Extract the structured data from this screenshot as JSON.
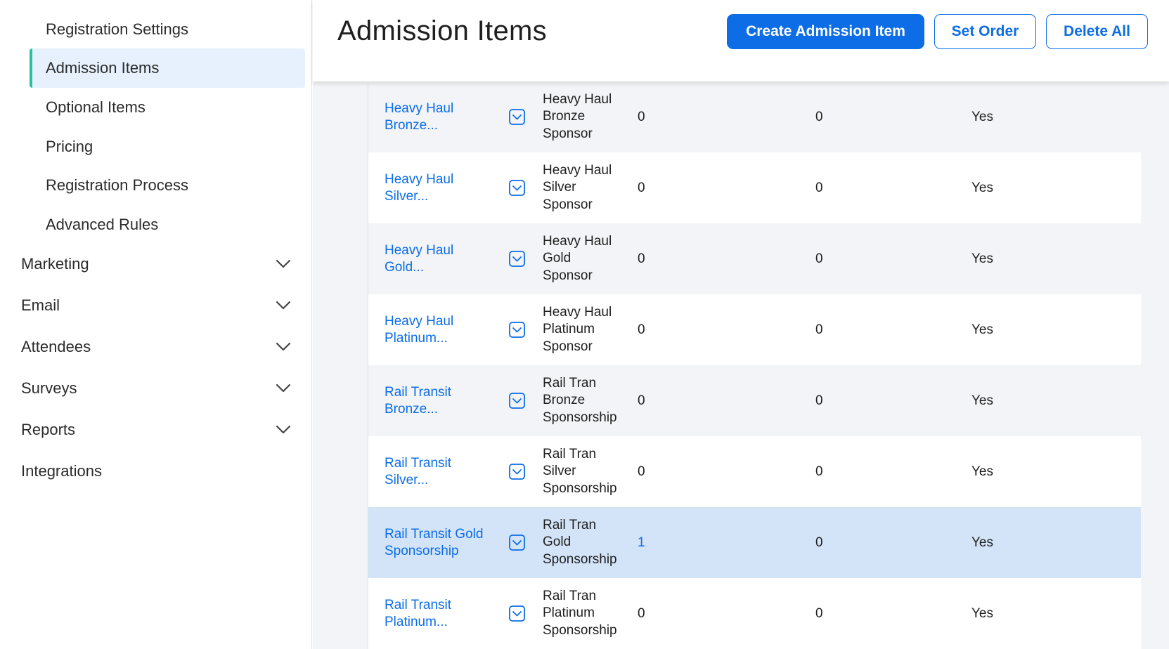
{
  "sidebar": {
    "sub_items": [
      {
        "label": "Registration Settings"
      },
      {
        "label": "Admission Items",
        "active": true
      },
      {
        "label": "Optional Items"
      },
      {
        "label": "Pricing"
      },
      {
        "label": "Registration Process"
      },
      {
        "label": "Advanced Rules"
      }
    ],
    "nav_items": [
      {
        "label": "Marketing",
        "icon": "chevron-down-icon"
      },
      {
        "label": "Email",
        "icon": "chevron-down-icon"
      },
      {
        "label": "Attendees",
        "icon": "chevron-down-icon"
      },
      {
        "label": "Surveys",
        "icon": "chevron-down-icon"
      },
      {
        "label": "Reports",
        "icon": "chevron-down-icon"
      },
      {
        "label": "Integrations"
      }
    ],
    "active_accent": "#27c1a3"
  },
  "header": {
    "title": "Admission Items",
    "create_label": "Create Admission Item",
    "set_order_label": "Set Order",
    "delete_all_label": "Delete All"
  },
  "colors": {
    "primary": "#0c6de6",
    "selected_row": "#d3e4f8",
    "shaded_row": "#f2f4f7"
  },
  "table": {
    "rows": [
      {
        "name": "Heavy Haul Bronze...",
        "name_lines": [
          "Heavy Haul",
          "Bronze..."
        ],
        "desc_lines": [
          "Heavy Haul",
          "Bronze",
          "Sponsor"
        ],
        "count": "0",
        "count2": "0",
        "active": "Yes"
      },
      {
        "name": "Heavy Haul Silver...",
        "name_lines": [
          "Heavy Haul",
          "Silver..."
        ],
        "desc_lines": [
          "Heavy Haul",
          "Silver",
          "Sponsor"
        ],
        "count": "0",
        "count2": "0",
        "active": "Yes"
      },
      {
        "name": "Heavy Haul Gold...",
        "name_lines": [
          "Heavy Haul",
          "Gold..."
        ],
        "desc_lines": [
          "Heavy Haul",
          "Gold",
          "Sponsor"
        ],
        "count": "0",
        "count2": "0",
        "active": "Yes"
      },
      {
        "name": "Heavy Haul Platinum...",
        "name_lines": [
          "Heavy Haul",
          "Platinum..."
        ],
        "desc_lines": [
          "Heavy Haul",
          "Platinum",
          "Sponsor"
        ],
        "count": "0",
        "count2": "0",
        "active": "Yes"
      },
      {
        "name": "Rail Transit Bronze...",
        "name_lines": [
          "Rail Transit",
          "Bronze..."
        ],
        "desc_lines": [
          "Rail Tran",
          "Bronze",
          "Sponsorship"
        ],
        "count": "0",
        "count2": "0",
        "active": "Yes"
      },
      {
        "name": "Rail Transit Silver...",
        "name_lines": [
          "Rail Transit",
          "Silver..."
        ],
        "desc_lines": [
          "Rail Tran",
          "Silver",
          "Sponsorship"
        ],
        "count": "0",
        "count2": "0",
        "active": "Yes"
      },
      {
        "name": "Rail Transit Gold Sponsorship",
        "name_lines": [
          "Rail Transit Gold",
          "Sponsorship"
        ],
        "desc_lines": [
          "Rail Tran",
          "Gold",
          "Sponsorship"
        ],
        "count": "1",
        "count2": "0",
        "active": "Yes",
        "selected": true
      },
      {
        "name": "Rail Transit Platinum...",
        "name_lines": [
          "Rail Transit",
          "Platinum..."
        ],
        "desc_lines": [
          "Rail Tran",
          "Platinum",
          "Sponsorship"
        ],
        "count": "0",
        "count2": "0",
        "active": "Yes"
      }
    ]
  }
}
